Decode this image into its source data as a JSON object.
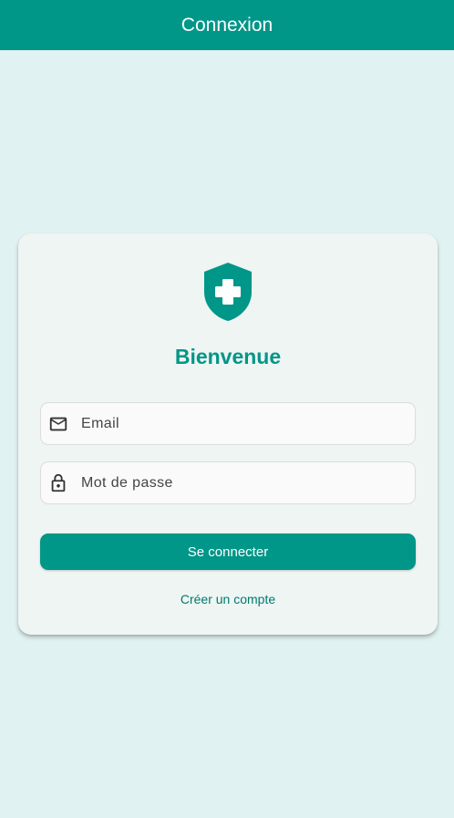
{
  "app_bar": {
    "title": "Connexion"
  },
  "card": {
    "logo_icon": "shield-plus-icon",
    "welcome": "Bienvenue",
    "email": {
      "icon": "mail-icon",
      "placeholder": "Email",
      "value": ""
    },
    "password": {
      "icon": "lock-icon",
      "placeholder": "Mot de passe",
      "value": ""
    },
    "login_label": "Se connecter",
    "register_label": "Créer un compte"
  },
  "colors": {
    "primary": "#009688",
    "background": "#e0f2f1",
    "card": "#eef5f3",
    "link": "#00796b"
  }
}
